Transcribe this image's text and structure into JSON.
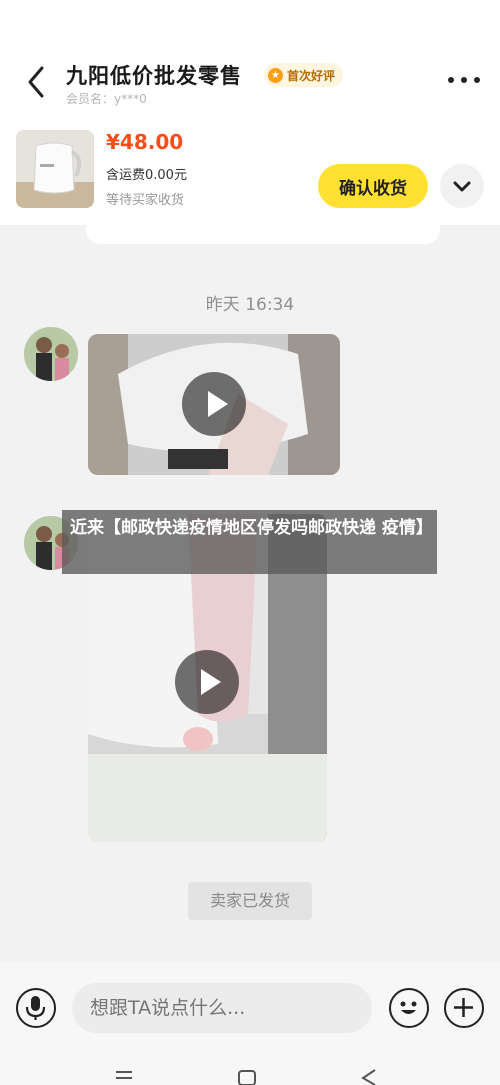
{
  "header": {
    "shop_name": "九阳低价批发零售",
    "badge_label": "首次好评",
    "member_label": "会员名：y***0"
  },
  "product": {
    "price": "¥48.00",
    "shipping": "含运费0.00元",
    "status": "等待买家收货",
    "confirm_button": "确认收货"
  },
  "chat": {
    "timestamp": "昨天 16:34",
    "system_message": "卖家已发货"
  },
  "overlay": {
    "text": "近来【邮政快递疫情地区停发吗邮政快递 疫情】"
  },
  "input": {
    "placeholder": "想跟TA说点什么..."
  },
  "icons": {
    "back": "chevron-left-icon",
    "more": "more-dots-icon",
    "expand": "chevron-down-icon",
    "play": "play-icon",
    "voice": "microphone-icon",
    "emoji": "smiley-icon",
    "plus": "plus-icon"
  },
  "colors": {
    "accent": "#ffe033",
    "price": "#ff4d1a",
    "badge": "#ff9d1a"
  }
}
